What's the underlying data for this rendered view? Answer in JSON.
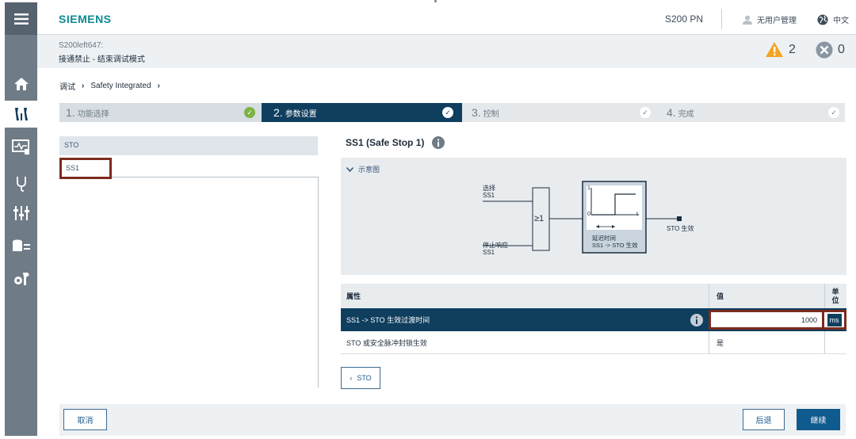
{
  "header": {
    "logo": "SIEMENS",
    "device": "S200 PN",
    "user": "无用户管理",
    "language": "中文"
  },
  "subheader": {
    "device_name": "S200left647:",
    "status": "接通禁止 - 结束调试模式",
    "warning_count": "2",
    "error_count": "0"
  },
  "breadcrumb": {
    "items": [
      "调试",
      "Safety Integrated"
    ],
    "separator": "›"
  },
  "steps": [
    {
      "num": "1.",
      "label": "功能选择",
      "done": true
    },
    {
      "num": "2.",
      "label": "参数设置",
      "done": true
    },
    {
      "num": "3.",
      "label": "控制",
      "done": true
    },
    {
      "num": "4.",
      "label": "完成",
      "done": true
    }
  ],
  "functions": {
    "items": [
      "STO",
      "SS1"
    ],
    "selected": "SS1"
  },
  "section": {
    "title": "SS1 (Safe Stop 1)",
    "diagram_toggle": "示意图"
  },
  "diagram": {
    "input1_line1": "选择",
    "input1_line2": "SS1",
    "input2_line1": "停止响应",
    "input2_line2": "SS1",
    "or_gate": "≥1",
    "timer_one": "1",
    "timer_zero": "0",
    "timer_t": "t",
    "timer_label1": "延迟时间",
    "timer_label2": "SS1 -> STO 生效",
    "output": "STO 生效"
  },
  "table": {
    "headers": {
      "property": "属性",
      "value": "值",
      "unit_line1": "单",
      "unit_line2": "位"
    },
    "rows": [
      {
        "property": "SS1 -> STO 生效过渡时间",
        "value": "1000",
        "unit": "ms"
      },
      {
        "property": "STO 或安全脉冲封锁生效",
        "value": "是",
        "unit": ""
      }
    ]
  },
  "buttons": {
    "sto_back": "STO",
    "cancel": "取消",
    "back": "后退",
    "next": "继续"
  },
  "colors": {
    "nav": "#6f7b86",
    "accent_dark": "#0f3e5e",
    "siemens_teal": "#0b8a92",
    "highlight_border": "#7b2a1e",
    "warning": "#f2a524"
  }
}
